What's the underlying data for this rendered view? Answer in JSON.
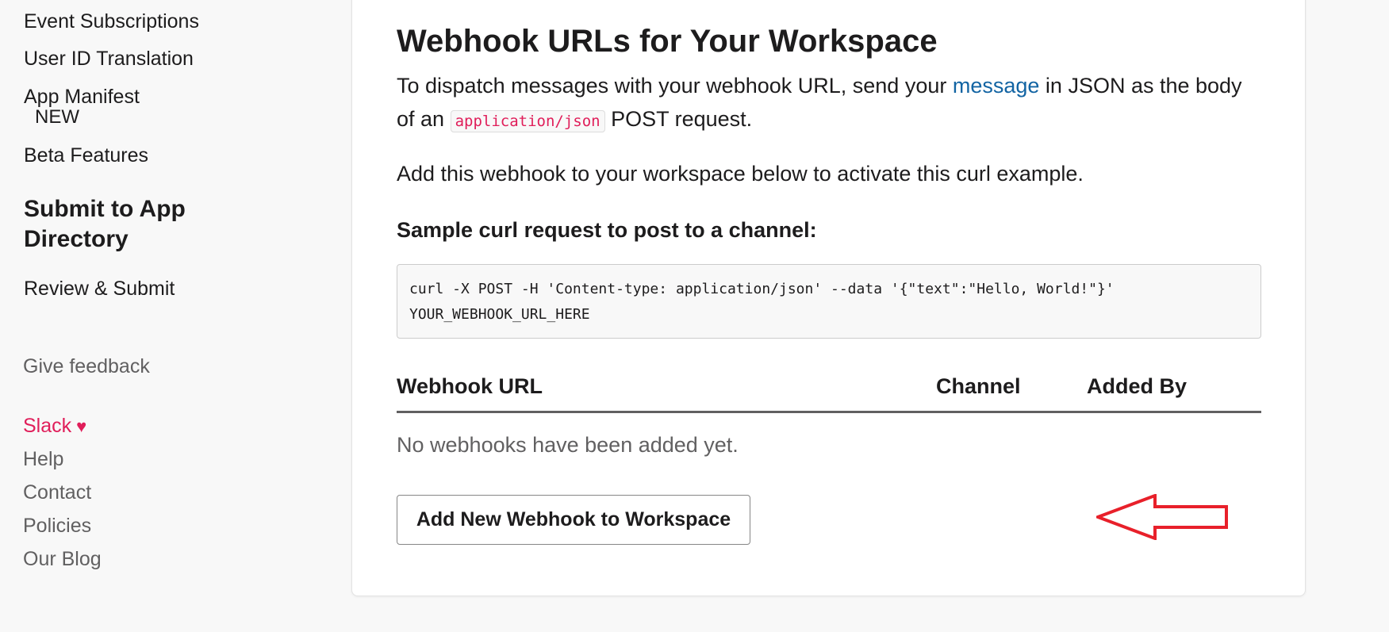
{
  "sidebar": {
    "links": [
      "Event Subscriptions",
      "User ID Translation",
      "App Manifest"
    ],
    "manifest_badge": "NEW",
    "beta": "Beta Features",
    "section_title": "Submit to App Directory",
    "review": "Review & Submit",
    "feedback": "Give feedback",
    "footer": {
      "slack": "Slack",
      "help": "Help",
      "contact": "Contact",
      "policies": "Policies",
      "blog": "Our Blog"
    }
  },
  "main": {
    "title": "Webhook URLs for Your Workspace",
    "desc_part1": "To dispatch messages with your webhook URL, send your ",
    "desc_link": "message",
    "desc_part2": " in JSON as the body of an ",
    "desc_code": "application/json",
    "desc_part3": " POST request.",
    "activate_text": "Add this webhook to your workspace below to activate this curl example.",
    "sample_label": "Sample curl request to post to a channel:",
    "curl_line1": "curl -X POST -H 'Content-type: application/json' --data '{\"text\":\"Hello, World!\"}'",
    "curl_line2": "YOUR_WEBHOOK_URL_HERE",
    "table": {
      "headers": [
        "Webhook URL",
        "Channel",
        "Added By"
      ],
      "empty": "No webhooks have been added yet."
    },
    "add_button": "Add New Webhook to Workspace"
  },
  "colors": {
    "link": "#1264a3",
    "slack_pink": "#e01e5a",
    "annotation_red": "#e8202a"
  }
}
